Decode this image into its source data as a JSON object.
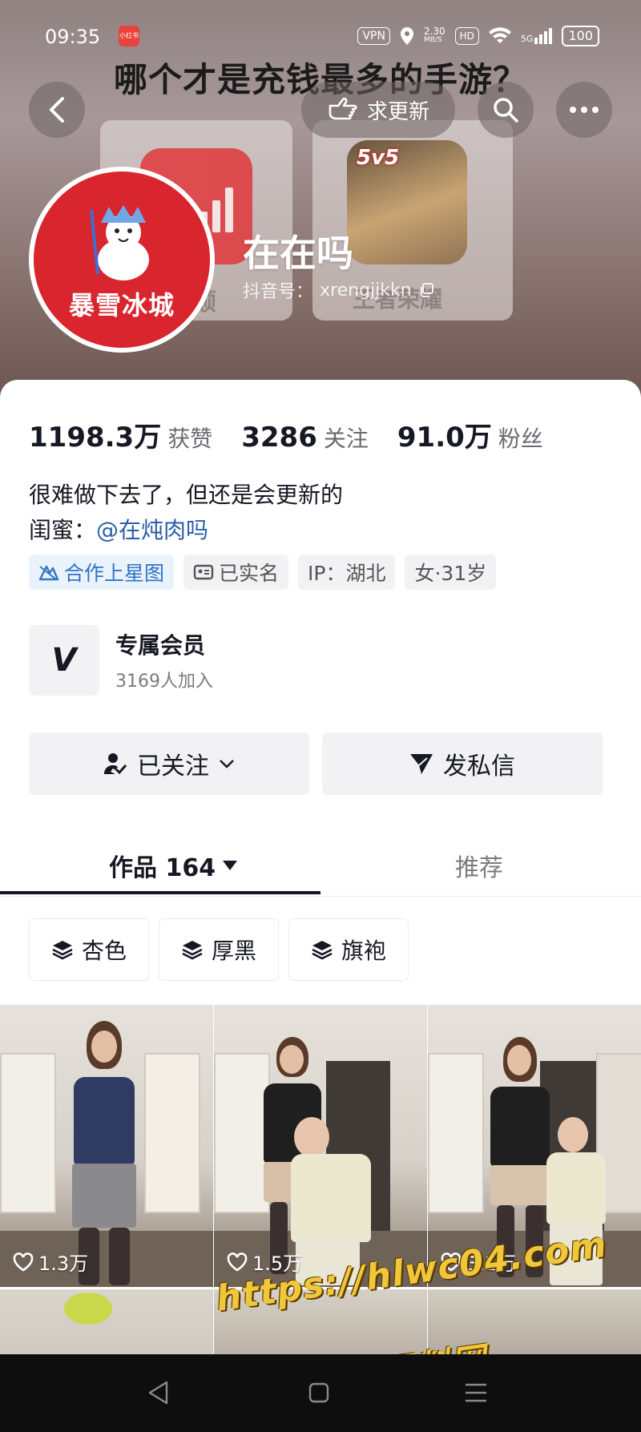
{
  "status_bar": {
    "time": "09:35",
    "notification_app": "小红书",
    "vpn": "VPN",
    "speed": "2.30",
    "speed_unit": "MB/S",
    "hd": "HD",
    "network": "5G",
    "battery": "100"
  },
  "cover": {
    "headline": "哪个才是充钱最多的手游？",
    "ghost_left": "顺",
    "ghost_right": "王者荣耀",
    "game_badge": "5v5"
  },
  "header": {
    "back_icon": "chevron-left-icon",
    "update_label": "求更新",
    "search_icon": "search-icon",
    "more_icon": "more-icon"
  },
  "profile": {
    "avatar_text": "暴雪冰城",
    "nickname": "在在吗",
    "douyin_id_label": "抖音号：",
    "douyin_id": "xrengjjkkn"
  },
  "stats": [
    {
      "value": "1198.3万",
      "label": "获赞"
    },
    {
      "value": "3286",
      "label": "关注"
    },
    {
      "value": "91.0万",
      "label": "粉丝"
    }
  ],
  "bio": {
    "line1": "很难做下去了，但还是会更新的",
    "line2_prefix": "闺蜜：",
    "mention": "@在炖肉吗"
  },
  "tags": [
    {
      "label": "合作上星图",
      "icon": "star-chart-icon"
    },
    {
      "label": "已实名",
      "icon": "id-card-icon"
    },
    {
      "label": "IP：湖北"
    },
    {
      "label": "女·31岁"
    }
  ],
  "membership": {
    "title": "专属会员",
    "count": "3169人加入",
    "logo_letter": "V"
  },
  "actions": {
    "follow_label": "已关注",
    "message_label": "发私信"
  },
  "tabs": {
    "works_label": "作品 164",
    "recommend_label": "推荐"
  },
  "collections": [
    "杏色",
    "厚黑",
    "旗袍"
  ],
  "videos": [
    {
      "likes": "1.3万"
    },
    {
      "likes": "1.5万"
    },
    {
      "likes": "3.1万"
    }
  ],
  "watermark": {
    "url": "https://hlwc04.com",
    "name": "黑料网"
  },
  "colors": {
    "mention_blue": "#2a5ea8",
    "tag_blue": "#2e74c8",
    "avatar_red": "#d9252d",
    "watermark_gold": "#f0c63a"
  }
}
